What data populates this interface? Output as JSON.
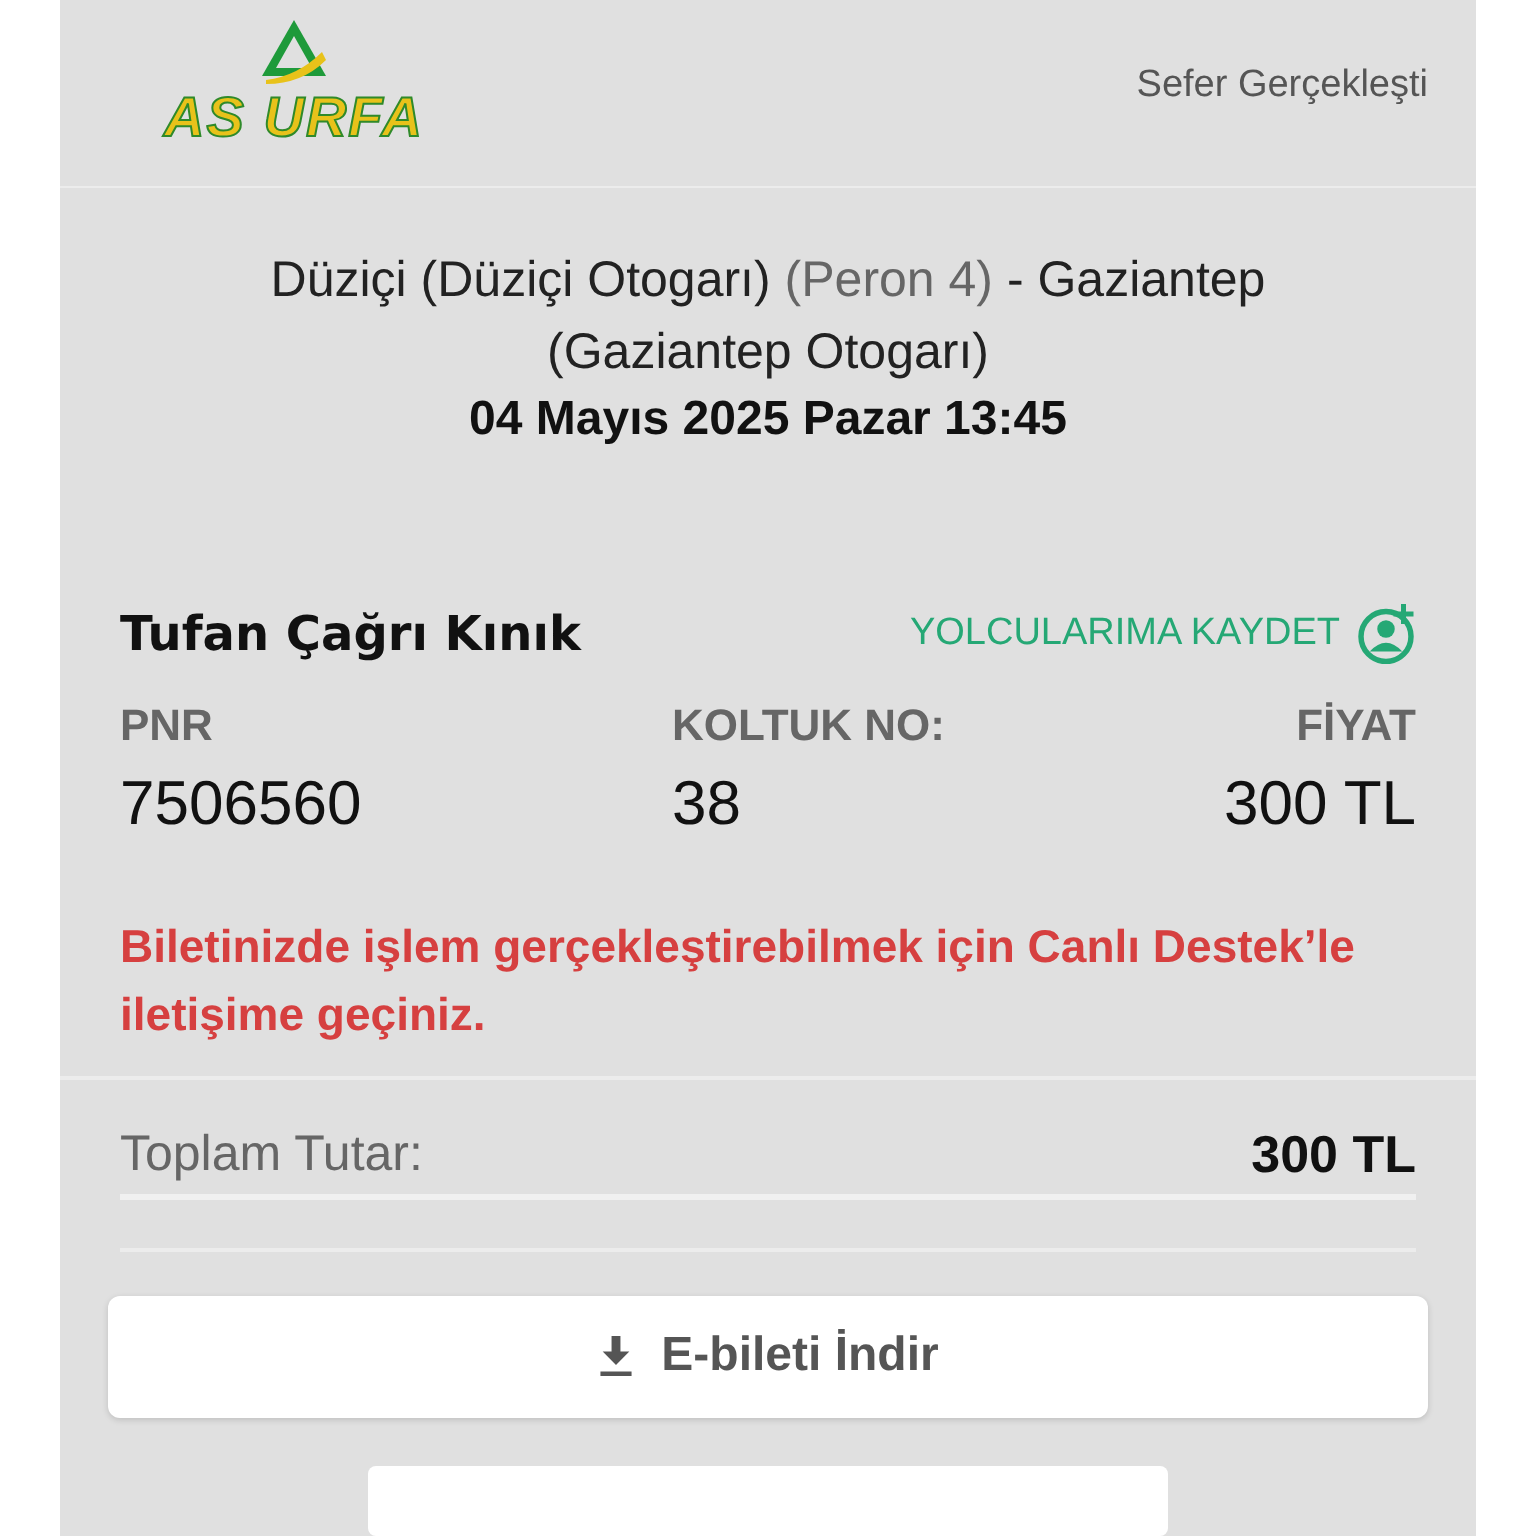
{
  "header": {
    "logo_text": "AS URFA",
    "status": "Sefer Gerçekleşti"
  },
  "trip": {
    "origin": "Düziçi (Düziçi Otogarı)",
    "platform": "(Peron 4)",
    "destination": "- Gaziantep",
    "destination_station": "(Gaziantep Otogarı)",
    "datetime": "04 Mayıs 2025 Pazar 13:45"
  },
  "passenger": {
    "name": "Tufan Çağrı Kınık",
    "save_link": "YOLCULARIMA KAYDET",
    "fields": [
      {
        "label": "PNR",
        "value": "7506560"
      },
      {
        "label": "KOLTUK NO:",
        "value": "38"
      },
      {
        "label": "FİYAT",
        "value": "300 TL"
      }
    ],
    "notice": "Biletinizde işlem gerçekleştirebilmek için Canlı Destek’le iletişime geçiniz."
  },
  "total": {
    "label": "Toplam Tutar:",
    "value": "300 TL"
  },
  "download_button": "E-bileti İndir"
}
